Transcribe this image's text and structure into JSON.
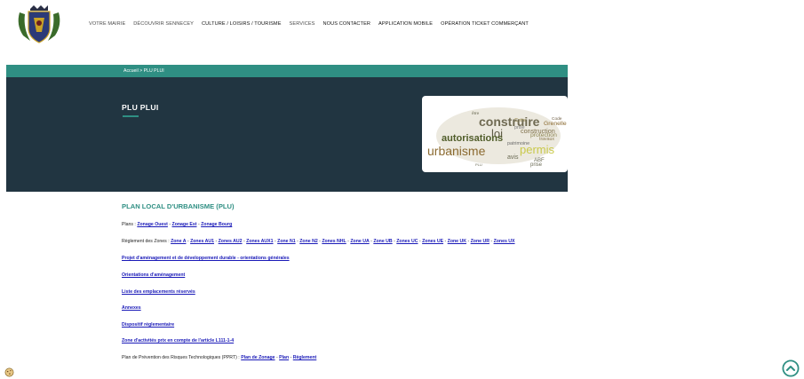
{
  "nav": {
    "items": [
      {
        "label": "VOTRE MAIRIE",
        "style": "light"
      },
      {
        "label": "DÉCOUVRIR SENNECEY",
        "style": "light"
      },
      {
        "label": "CULTURE / LOISIRS / TOURISME",
        "style": "dark"
      },
      {
        "label": "SERVICES",
        "style": "light"
      },
      {
        "label": "NOUS CONTACTER",
        "style": "dark"
      },
      {
        "label": "APPLICATION MOBILE",
        "style": "dark"
      },
      {
        "label": "OPÉRATION TICKET COMMERÇANT",
        "style": "dark"
      }
    ]
  },
  "breadcrumb": {
    "text": "Accueil > PLU PLUI"
  },
  "hero": {
    "title": "PLU PLUI"
  },
  "wordcloud": {
    "words": [
      "construire",
      "loi",
      "autorisations",
      "urbanisme",
      "permis",
      "Code",
      "Grenelle",
      "construction",
      "protection",
      "Cette",
      "avis",
      "ABF",
      "prise",
      "travaux",
      "patrimoine",
      "documents",
      "être",
      "PLU",
      "peut",
      "application"
    ]
  },
  "section": {
    "title": "PLAN LOCAL D'URBANISME (PLU)"
  },
  "plans": {
    "prefix": "Plans : ",
    "links": [
      "Zonage Ouest",
      "Zonage Est",
      "Zonage Bourg"
    ],
    "sep": " - "
  },
  "reglement": {
    "prefix": "Règlement des Zones : ",
    "links": [
      "Zone A",
      "Zones AU1",
      "Zones AU2",
      "Zones AUX1",
      "Zone N1",
      "Zone N2",
      "Zones NHL",
      "Zone UA",
      "Zone UB",
      "Zones UC",
      "Zones UE",
      "Zone UK",
      "Zone UR",
      "Zones UX"
    ],
    "sep": " - "
  },
  "links": [
    "Projet d'aménagement et de développement durable - orientations générales",
    "Orientations d'aménagement",
    "Liste des emplacements réservés",
    "Annexes",
    "Dispositif réglementaire",
    "Zone d'activités prix en compte de l'article L111-1-4"
  ],
  "pprt": {
    "prefix": "Plan de Prévention des Risques Technologiques (PPRT) : ",
    "links": [
      "Plan de Zonage",
      "Plan",
      "Règlement"
    ],
    "sep": " - "
  },
  "colors": {
    "teal": "#2f8f83",
    "navy": "#213541",
    "link": "#1a1ab8"
  }
}
